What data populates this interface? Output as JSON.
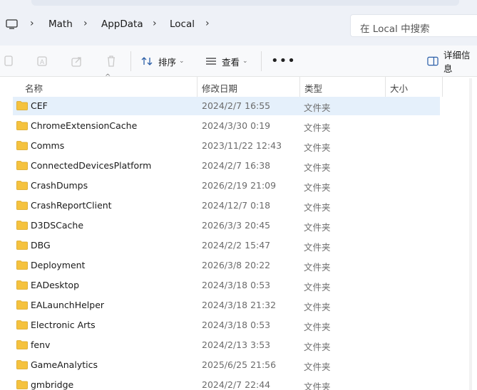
{
  "breadcrumb": {
    "items": [
      "Math",
      "AppData",
      "Local"
    ]
  },
  "search": {
    "placeholder": "在 Local 中搜索"
  },
  "toolbar": {
    "sort_label": "排序",
    "view_label": "查看",
    "details_label": "详细信息"
  },
  "columns": {
    "name": "名称",
    "modified": "修改日期",
    "type": "类型",
    "size": "大小"
  },
  "files": [
    {
      "name": "CEF",
      "modified": "2024/2/7 16:55",
      "type": "文件夹",
      "selected": true
    },
    {
      "name": "ChromeExtensionCache",
      "modified": "2024/3/30 0:19",
      "type": "文件夹"
    },
    {
      "name": "Comms",
      "modified": "2023/11/22 12:43",
      "type": "文件夹"
    },
    {
      "name": "ConnectedDevicesPlatform",
      "modified": "2024/2/7 16:38",
      "type": "文件夹"
    },
    {
      "name": "CrashDumps",
      "modified": "2026/2/19 21:09",
      "type": "文件夹"
    },
    {
      "name": "CrashReportClient",
      "modified": "2024/12/7 0:18",
      "type": "文件夹"
    },
    {
      "name": "D3DSCache",
      "modified": "2026/3/3 20:45",
      "type": "文件夹"
    },
    {
      "name": "DBG",
      "modified": "2024/2/2 15:47",
      "type": "文件夹"
    },
    {
      "name": "Deployment",
      "modified": "2026/3/8 20:22",
      "type": "文件夹"
    },
    {
      "name": "EADesktop",
      "modified": "2024/3/18 0:53",
      "type": "文件夹"
    },
    {
      "name": "EALaunchHelper",
      "modified": "2024/3/18 21:32",
      "type": "文件夹"
    },
    {
      "name": "Electronic Arts",
      "modified": "2024/3/18 0:53",
      "type": "文件夹"
    },
    {
      "name": "fenv",
      "modified": "2024/2/13 3:53",
      "type": "文件夹"
    },
    {
      "name": "GameAnalytics",
      "modified": "2025/6/25 21:56",
      "type": "文件夹"
    },
    {
      "name": "gmbridge",
      "modified": "2024/2/7 22:44",
      "type": "文件夹"
    }
  ],
  "colors": {
    "selected_row": "#e5f0fb",
    "folder_yellow": "#f5c23e",
    "toolbar_bg": "#f8f9fb"
  }
}
